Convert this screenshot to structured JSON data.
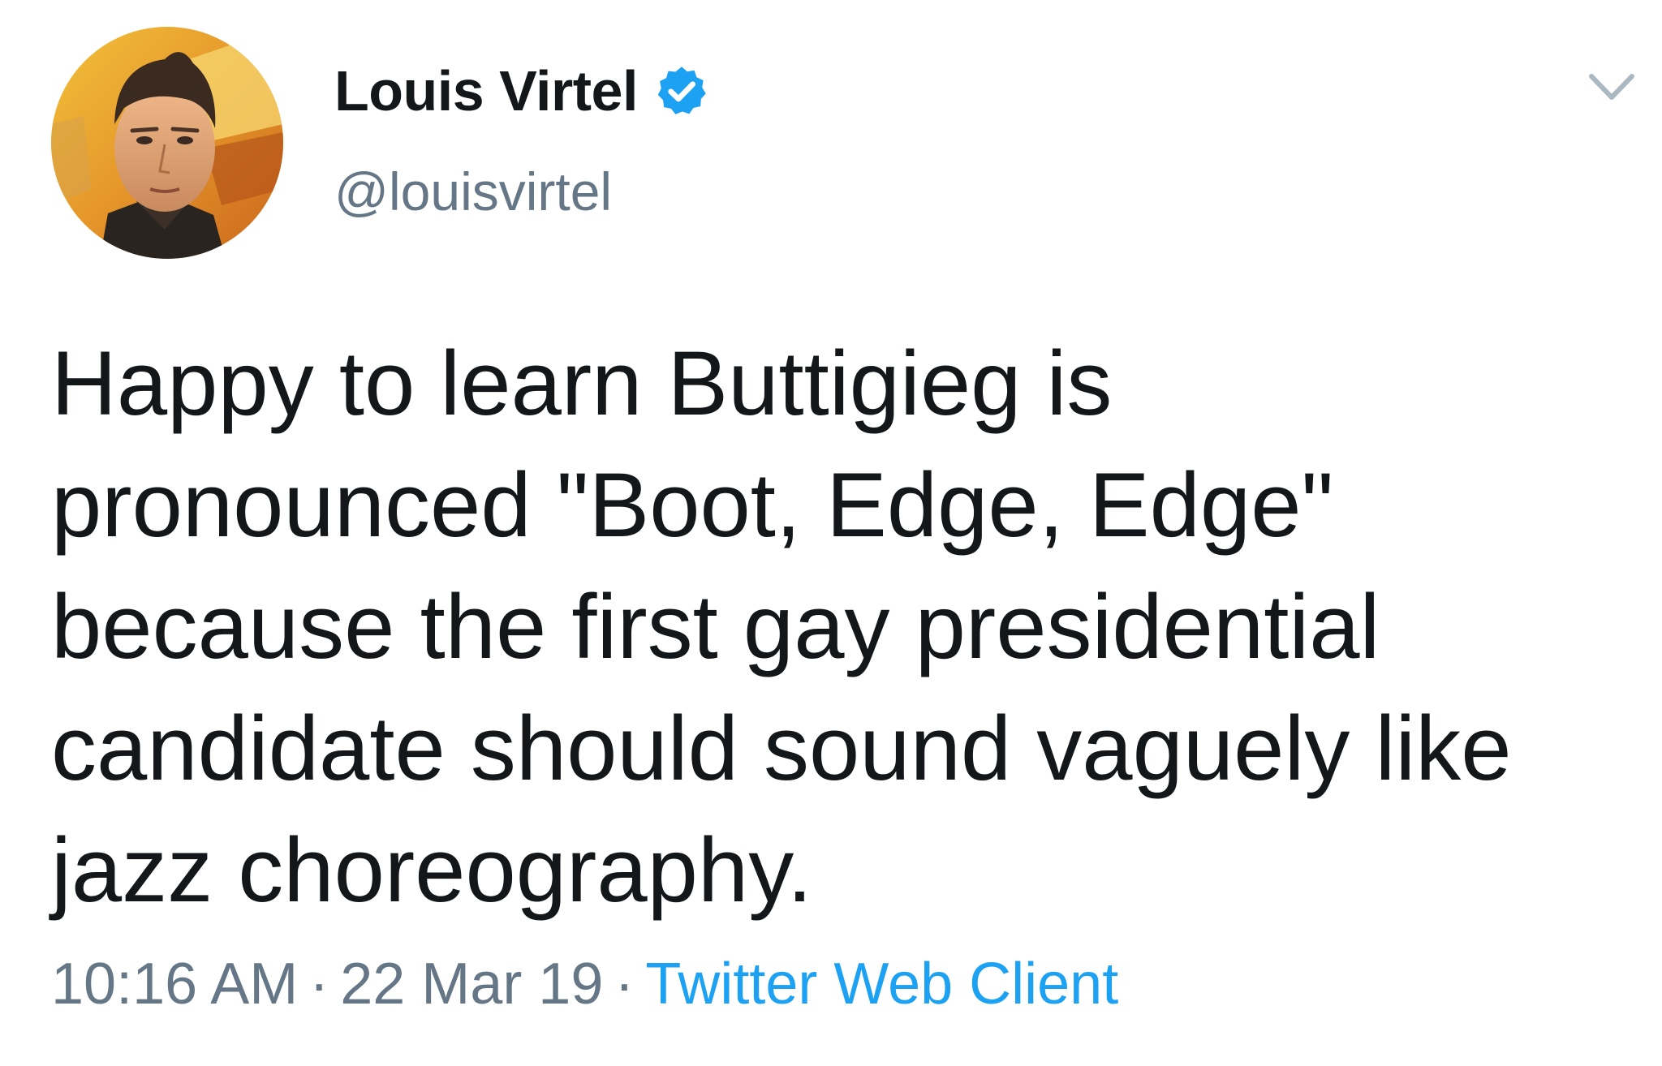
{
  "user": {
    "display_name": "Louis Virtel",
    "handle": "@louisvirtel",
    "verified": true,
    "verified_icon": "verified-badge-icon",
    "verified_color": "#1da1f2",
    "avatar_icon": "profile-photo-avatar"
  },
  "menu": {
    "icon": "chevron-down-icon"
  },
  "tweet": {
    "lines": [
      "Happy to learn Buttigieg is",
      "pronounced \"Boot, Edge, Edge\"",
      "because the first gay presidential",
      "candidate should sound vaguely like",
      "jazz choreography."
    ]
  },
  "meta": {
    "time": "10:16 AM",
    "separator": "·",
    "date": "22 Mar 19",
    "source": "Twitter Web Client",
    "source_color": "#1da1f2"
  }
}
